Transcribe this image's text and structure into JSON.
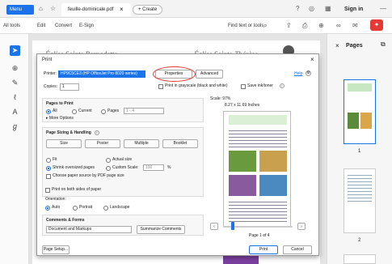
{
  "titlebar": {
    "menu": "Menu",
    "tab_title": "feuille-dominicale.pdf",
    "create": "+ Create",
    "signin": "Sign in"
  },
  "menubar": {
    "items": [
      "All tools",
      "Edit",
      "Convert",
      "E-Sign"
    ],
    "find": "Find text or tools"
  },
  "document": {
    "left_title": "Église Sainte Bernadette",
    "right_title": "Église Sainte-Thérèse"
  },
  "pages_panel": {
    "title": "Pages",
    "thumb1_label": "1",
    "thumb2_label": "2"
  },
  "dialog": {
    "title": "Print",
    "printer_label": "Printer:",
    "printer_value": "HP9C5CE3 (HP OfficeJet Pro 8020 series)",
    "properties": "Properties",
    "advanced": "Advanced",
    "help": "Help",
    "copies_label": "Copies:",
    "copies_value": "1",
    "grayscale": "Print in grayscale (black and white)",
    "save_ink": "Save ink/toner",
    "pages_to_print": "Pages to Print",
    "all": "All",
    "current": "Current",
    "pages": "Pages",
    "pages_value": "1 - 4",
    "more_options": "More Options",
    "sizing": "Page Sizing & Handling",
    "size": "Size",
    "poster": "Poster",
    "multiple": "Multiple",
    "booklet": "Booklet",
    "fit": "Fit",
    "actual_size": "Actual size",
    "shrink": "Shrink oversized pages",
    "custom_scale": "Custom Scale:",
    "custom_scale_value": "100",
    "percent": "%",
    "choose_paper": "Choose paper source by PDF page size",
    "both_sides": "Print on both sides of paper",
    "orientation": "Orientation:",
    "auto": "Auto",
    "portrait": "Portrait",
    "landscape": "Landscape",
    "comments_forms": "Comments & Forms",
    "comments_value": "Document and Markups",
    "summarize": "Summarize Comments",
    "page_setup": "Page Setup...",
    "print": "Print",
    "cancel": "Cancel",
    "scale": "Scale: 97%",
    "paper_size": "8.27 x 11.69 Inches",
    "page_of": "Page 1 of 4"
  },
  "colors": {
    "accent": "#1a73e8",
    "highlight": "#e53935"
  }
}
